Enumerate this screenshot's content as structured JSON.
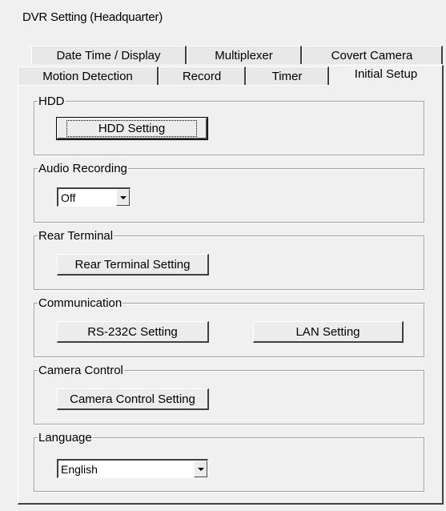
{
  "window": {
    "title": "DVR Setting  (Headquarter)"
  },
  "tabs": {
    "row1": [
      {
        "label": "Date Time / Display"
      },
      {
        "label": "Multiplexer"
      },
      {
        "label": "Covert Camera"
      }
    ],
    "row2": [
      {
        "label": "Motion Detection"
      },
      {
        "label": "Record"
      },
      {
        "label": "Timer"
      },
      {
        "label": "Initial Setup",
        "active": true
      }
    ]
  },
  "groups": {
    "hdd": {
      "legend": "HDD",
      "button": "HDD Setting"
    },
    "audio": {
      "legend": "Audio Recording",
      "value": "Off"
    },
    "rear": {
      "legend": "Rear Terminal",
      "button": "Rear Terminal Setting"
    },
    "comm": {
      "legend": "Communication",
      "button_rs232": "RS-232C Setting",
      "button_lan": "LAN Setting"
    },
    "camera": {
      "legend": "Camera Control",
      "button": "Camera Control Setting"
    },
    "language": {
      "legend": "Language",
      "value": "English"
    }
  }
}
